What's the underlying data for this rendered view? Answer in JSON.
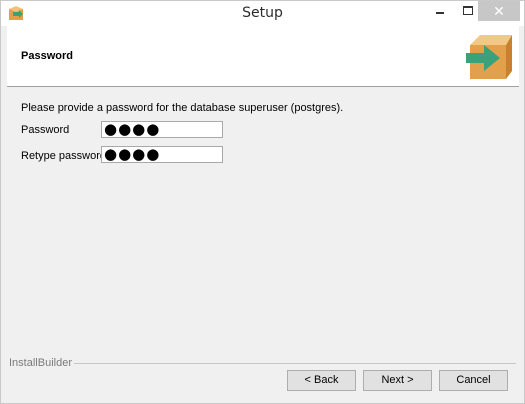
{
  "window": {
    "title": "Setup",
    "minimize_glyph": "minimize-icon",
    "maximize_glyph": "maximize-icon",
    "close_glyph": "close-icon",
    "close_symbol": "✕"
  },
  "header": {
    "page_title": "Password",
    "icon": "installer-box-arrow-icon"
  },
  "form": {
    "intro_text": "Please provide a password for the database superuser (postgres).",
    "password_label": "Password",
    "password_value": "●●●●",
    "retype_label": "Retype password",
    "retype_value": "●●●●"
  },
  "footer": {
    "brand": "InstallBuilder",
    "back_label": "< Back",
    "next_label": "Next >",
    "cancel_label": "Cancel"
  },
  "colors": {
    "box_orange": "#e3a04a",
    "arrow_green": "#3aa17a"
  }
}
